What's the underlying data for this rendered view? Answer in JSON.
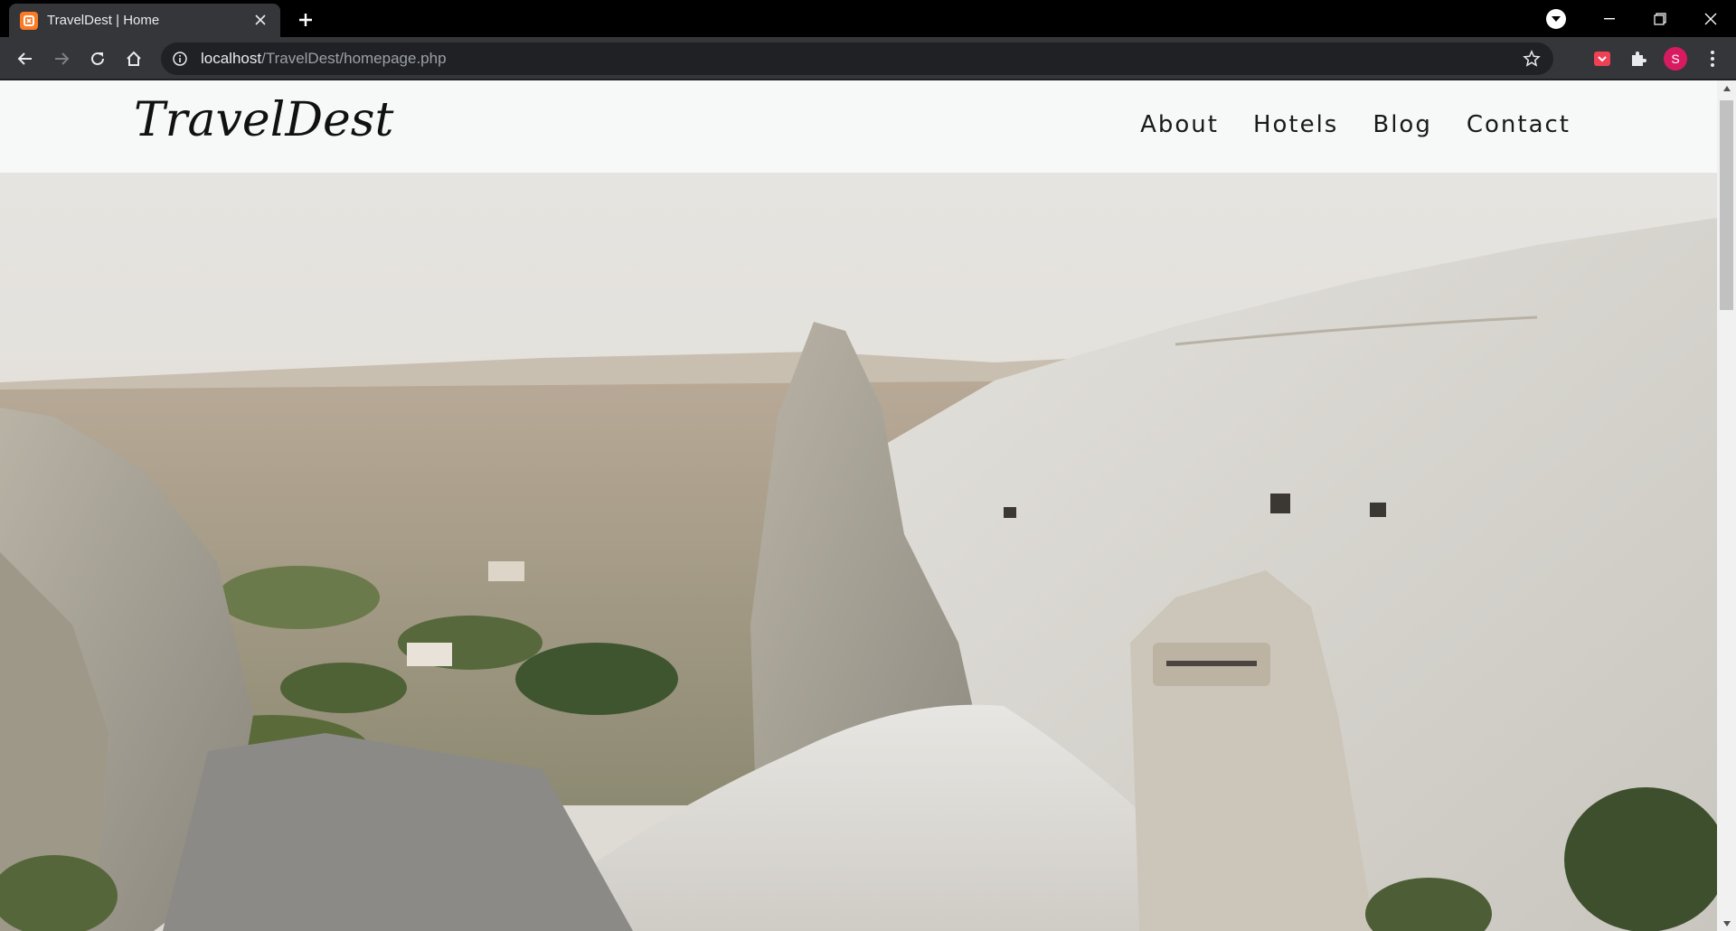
{
  "browser": {
    "tab_title": "TravelDest | Home",
    "url_host": "localhost",
    "url_path": "/TravelDest/homepage.php",
    "profile_initial": "S",
    "colors": {
      "tab_favicon": "#fb7a24",
      "avatar": "#d81b60"
    }
  },
  "site": {
    "logo": "TravelDest",
    "nav": [
      "About",
      "Hotels",
      "Blog",
      "Contact"
    ]
  },
  "hero": {
    "image": "rock-formations-landscape"
  }
}
